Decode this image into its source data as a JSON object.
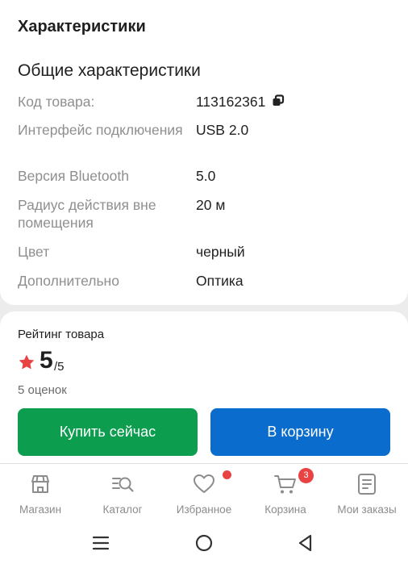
{
  "specs": {
    "section_title": "Характеристики",
    "group_title": "Общие характеристики",
    "rows": [
      {
        "name": "Код товара:",
        "value": "113162361"
      },
      {
        "name": "Интерфейс подключения",
        "value": "USB 2.0"
      },
      {
        "name": "Версия Bluetooth",
        "value": "5.0"
      },
      {
        "name": "Радиус действия вне помещения",
        "value": "20 м"
      },
      {
        "name": "Цвет",
        "value": "черный"
      },
      {
        "name": "Дополнительно",
        "value": "Оптика"
      }
    ]
  },
  "rating": {
    "title": "Рейтинг товара",
    "value": "5",
    "max": "/5",
    "count": "5 оценок"
  },
  "actions": {
    "buy_now": "Купить сейчас",
    "add_to_cart": "В корзину"
  },
  "nav": {
    "items": [
      {
        "label": "Магазин",
        "icon": "store-icon"
      },
      {
        "label": "Каталог",
        "icon": "catalog-search-icon"
      },
      {
        "label": "Избранное",
        "icon": "heart-icon"
      },
      {
        "label": "Корзина",
        "icon": "cart-icon"
      },
      {
        "label": "Мои заказы",
        "icon": "orders-icon"
      }
    ],
    "cart_badge": "3"
  },
  "colors": {
    "buy_button": "#0c9d4f",
    "cart_button": "#0a6ccc",
    "star": "#e84243",
    "badge": "#e84243"
  }
}
